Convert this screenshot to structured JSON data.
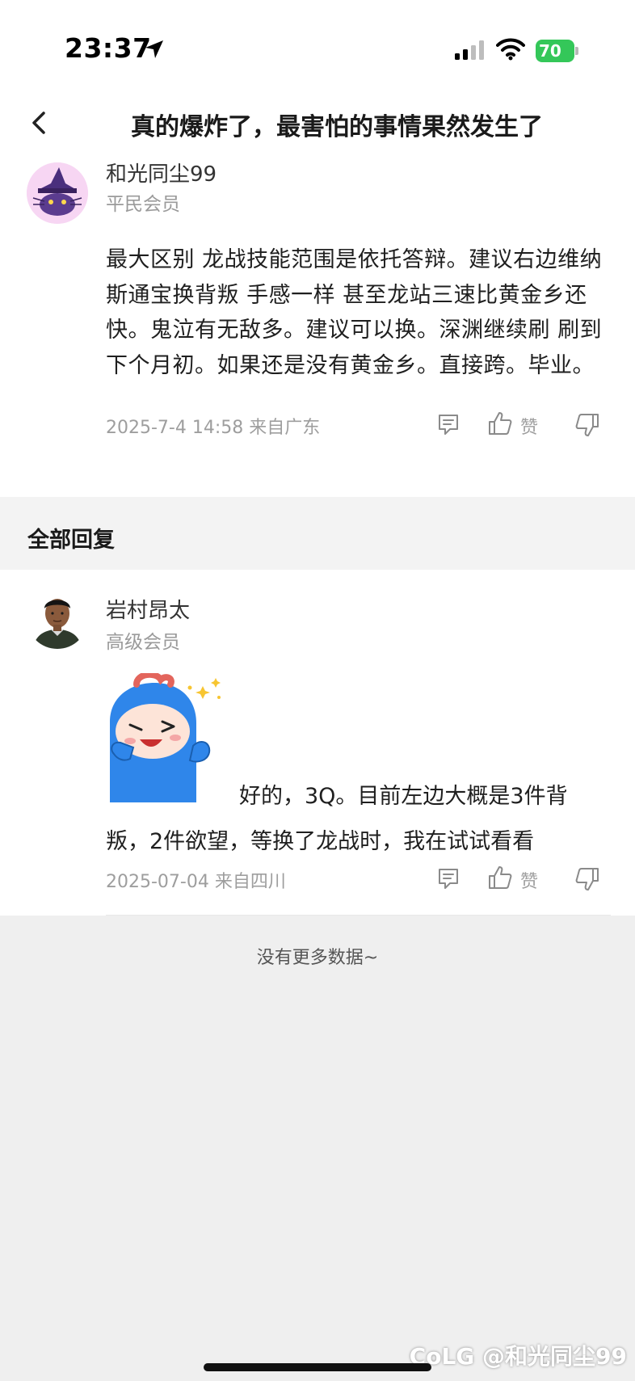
{
  "status_bar": {
    "time": "23:37",
    "battery": "70"
  },
  "navbar": {
    "title": "真的爆炸了，最害怕的事情果然发生了"
  },
  "post": {
    "username": "和光同尘99",
    "level": "平民会员",
    "body": "最大区别 龙战技能范围是依托答辩。建议右边维纳斯通宝换背叛 手感一样 甚至龙站三速比黄金乡还快。鬼泣有无敌多。建议可以换。深渊继续刷 刷到下个月初。如果还是没有黄金乡。直接跨。毕业。",
    "meta": "2025-7-4 14:58  来自广东",
    "like_label": "赞"
  },
  "section": {
    "title": "全部回复"
  },
  "reply": {
    "username": "岩村昂太",
    "level": "高级会员",
    "body": "好的，3Q。目前左边大概是3件背叛，2件欲望，等换了龙战时，我在试试看看",
    "meta": "2025-07-04 来自四川",
    "like_label": "赞"
  },
  "footer": {
    "no_more": "没有更多数据~",
    "watermark": "CoLG @和光同尘99"
  },
  "icons": {
    "location": "location-arrow-icon",
    "signal": "cellular-signal-icon",
    "wifi": "wifi-icon",
    "battery": "battery-icon",
    "back": "chevron-left-icon",
    "comment": "comment-icon",
    "like": "thumbs-up-icon",
    "dislike": "thumbs-down-icon"
  },
  "colors": {
    "battery": "#34c759",
    "section_background": "#f3f3f3",
    "page_background": "#efefef",
    "meta_text": "#9e9e9e"
  }
}
